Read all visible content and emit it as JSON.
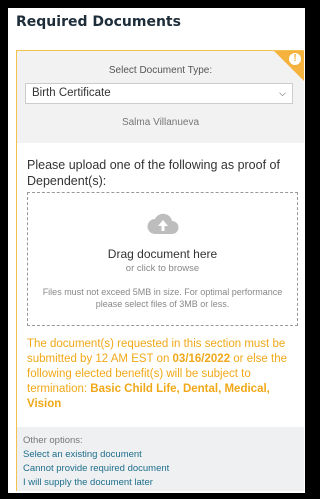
{
  "page": {
    "title": "Required Documents"
  },
  "card": {
    "select_label": "Select Document Type:",
    "selected_document": "Birth Certificate",
    "dependent_name": "Salma Villanueva",
    "instruction": "Please upload one of the following as proof of Dependent(s):",
    "dropzone": {
      "drag_text": "Drag document here",
      "browse_text": "or click to browse",
      "limit_text": "Files must not exceed 5MB in size. For optimal performance please select files of 3MB or less."
    },
    "warning": {
      "part1": "The document(s) requested in this section must be submitted by 12 AM EST on ",
      "due_date": "03/16/2022",
      "part2": " or else the following elected benefit(s) will be subject to termination: ",
      "benefits": "Basic Child Life, Dental, Medical, Vision"
    },
    "options": {
      "label": "Other options:",
      "links": [
        "Select an existing document",
        "Cannot provide required document",
        "I will supply the document later"
      ]
    }
  },
  "colors": {
    "accent": "#f6b23f",
    "warning_text": "#f0a818",
    "link": "#1e6e8c"
  },
  "icons": {
    "corner": "exclamation-icon",
    "upload": "cloud-upload-icon",
    "dropdown": "chevron-down-icon"
  }
}
